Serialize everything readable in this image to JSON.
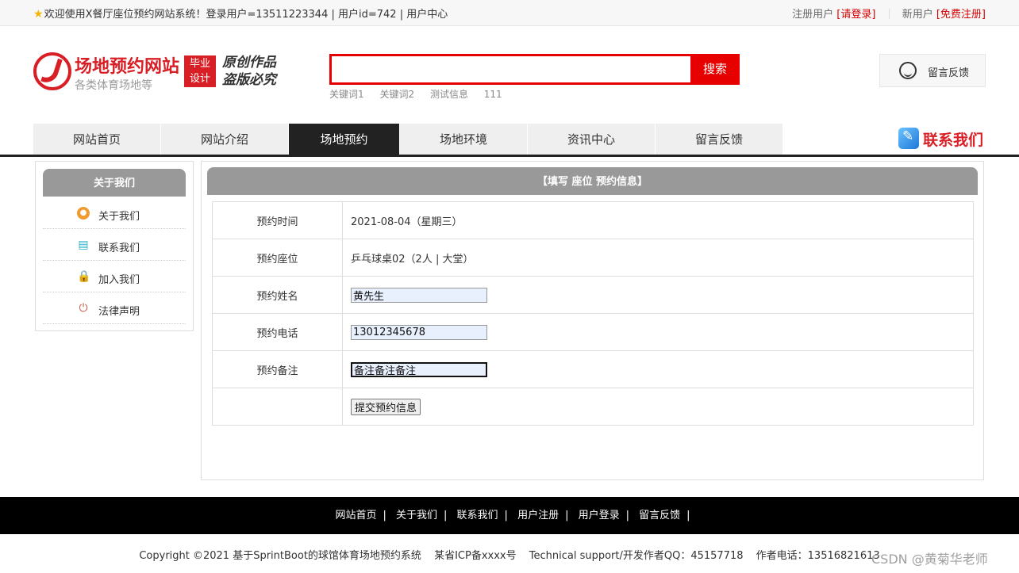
{
  "topbar": {
    "welcome": "欢迎使用X餐厅座位预约网站系统！登录用户=13511223344 | 用户id=742 | 用户中心",
    "registered_label": "注册用户",
    "login_link": "[请登录]",
    "new_user_label": "新用户",
    "register_link": "[免费注册]"
  },
  "header": {
    "site_title": "场地预约网站",
    "site_subtitle": "各类体育场地等",
    "badge_line1": "毕业",
    "badge_line2": "设计",
    "slogan_line1": "原创作品",
    "slogan_line2": "盗版必究",
    "search_value": "",
    "search_button": "搜索",
    "hot_words": [
      "关键词1",
      "关键词2",
      "测试信息",
      "111"
    ],
    "feedback_button": "留言反馈"
  },
  "nav": {
    "items": [
      "网站首页",
      "网站介绍",
      "场地预约",
      "场地环境",
      "资讯中心",
      "留言反馈"
    ],
    "active_index": 2,
    "contact_us": "联系我们"
  },
  "sidebar": {
    "title": "关于我们",
    "items": [
      {
        "label": "关于我们",
        "icon": "info-circle-icon"
      },
      {
        "label": "联系我们",
        "icon": "clipboard-icon"
      },
      {
        "label": "加入我们",
        "icon": "lock-icon"
      },
      {
        "label": "法律声明",
        "icon": "power-icon"
      }
    ]
  },
  "main": {
    "title": "【填写 座位 预约信息】",
    "rows": {
      "time_label": "预约时间",
      "time_value": "2021-08-04（星期三）",
      "seat_label": "预约座位",
      "seat_value": "乒乓球桌02（2人 | 大堂）",
      "name_label": "预约姓名",
      "name_value": "黄先生",
      "phone_label": "预约电话",
      "phone_value": "13012345678",
      "remark_label": "预约备注",
      "remark_value": "备注备注备注"
    },
    "submit_label": "提交预约信息"
  },
  "footer": {
    "links": [
      "网站首页",
      "关于我们",
      "联系我们",
      "用户注册",
      "用户登录",
      "留言反馈"
    ],
    "copyright": "Copyright ©2021 基于SprintBoot的球馆体育场地预约系统",
    "icp": "某省ICP备xxxx号",
    "support": "Technical support/开发作者QQ：45157718",
    "phone": "作者电话：13516821613"
  },
  "watermark": "CSDN @黄菊华老师",
  "colors": {
    "accent_red": "#d91f26",
    "search_red": "#e60000",
    "nav_active": "#222222",
    "panel_header": "#999999"
  }
}
